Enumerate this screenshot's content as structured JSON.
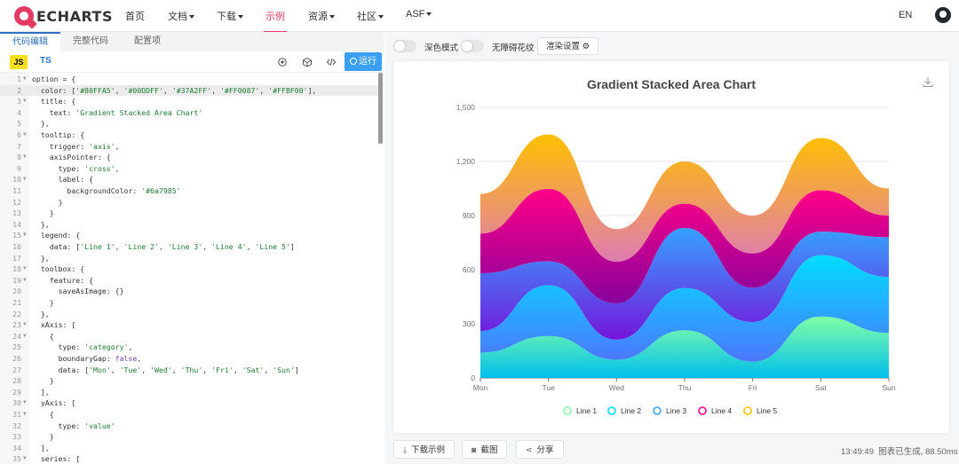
{
  "nav": {
    "logo": "ECHARTS",
    "items": [
      {
        "label": "首页",
        "caret": false
      },
      {
        "label": "文档",
        "caret": true
      },
      {
        "label": "下载",
        "caret": true
      },
      {
        "label": "示例",
        "caret": false,
        "active": true
      },
      {
        "label": "资源",
        "caret": true
      },
      {
        "label": "社区",
        "caret": true
      },
      {
        "label": "ASF",
        "caret": true
      }
    ],
    "lang": "EN",
    "github_icon": "github-icon"
  },
  "editor": {
    "tabs": [
      "代码编辑",
      "完整代码",
      "配置项"
    ],
    "active_tab": "代码编辑",
    "js_badge": "JS",
    "ts_label": "TS",
    "run_label": "运行",
    "lines": [
      {
        "n": "1",
        "fold": true,
        "html": "option = {"
      },
      {
        "n": "2",
        "fold": false,
        "hl": true,
        "html": "  color: [<s>'#80FFA5'</s>, <s>'#00DDFF'</s>, <s>'#37A2FF'</s>, <s>'#FF0087'</s>, <s>'#FFBF00'</s>],"
      },
      {
        "n": "3",
        "fold": true,
        "html": "  title: {"
      },
      {
        "n": "4",
        "fold": false,
        "html": "    text: <s>'Gradient Stacked Area Chart'</s>"
      },
      {
        "n": "5",
        "fold": false,
        "html": "  },"
      },
      {
        "n": "6",
        "fold": true,
        "html": "  tooltip: {"
      },
      {
        "n": "7",
        "fold": false,
        "html": "    trigger: <s>'axis'</s>,"
      },
      {
        "n": "8",
        "fold": true,
        "html": "    axisPointer: {"
      },
      {
        "n": "9",
        "fold": false,
        "html": "      type: <s>'cross'</s>,"
      },
      {
        "n": "10",
        "fold": true,
        "html": "      label: {"
      },
      {
        "n": "11",
        "fold": false,
        "html": "        backgroundColor: <s>'#6a7985'</s>"
      },
      {
        "n": "12",
        "fold": false,
        "html": "      }"
      },
      {
        "n": "13",
        "fold": false,
        "html": "    }"
      },
      {
        "n": "14",
        "fold": false,
        "html": "  },"
      },
      {
        "n": "15",
        "fold": true,
        "html": "  legend: {"
      },
      {
        "n": "16",
        "fold": false,
        "html": "    data: [<s>'Line 1'</s>, <s>'Line 2'</s>, <s>'Line 3'</s>, <s>'Line 4'</s>, <s>'Line 5'</s>]"
      },
      {
        "n": "17",
        "fold": false,
        "html": "  },"
      },
      {
        "n": "18",
        "fold": true,
        "html": "  toolbox: {"
      },
      {
        "n": "19",
        "fold": true,
        "html": "    feature: {"
      },
      {
        "n": "20",
        "fold": false,
        "html": "      saveAsImage: {}"
      },
      {
        "n": "21",
        "fold": false,
        "html": "    }"
      },
      {
        "n": "22",
        "fold": false,
        "html": "  },"
      },
      {
        "n": "23",
        "fold": true,
        "html": "  xAxis: ["
      },
      {
        "n": "24",
        "fold": true,
        "html": "    {"
      },
      {
        "n": "25",
        "fold": false,
        "html": "      type: <s>'category'</s>,"
      },
      {
        "n": "26",
        "fold": false,
        "html": "      boundaryGap: <k>false</k>,"
      },
      {
        "n": "27",
        "fold": false,
        "html": "      data: [<s>'Mon'</s>, <s>'Tue'</s>, <s>'Wed'</s>, <s>'Thu'</s>, <s>'Fri'</s>, <s>'Sat'</s>, <s>'Sun'</s>]"
      },
      {
        "n": "28",
        "fold": false,
        "html": "    }"
      },
      {
        "n": "29",
        "fold": false,
        "html": "  ],"
      },
      {
        "n": "30",
        "fold": true,
        "html": "  yAxis: ["
      },
      {
        "n": "31",
        "fold": true,
        "html": "    {"
      },
      {
        "n": "32",
        "fold": false,
        "html": "      type: <s>'value'</s>"
      },
      {
        "n": "33",
        "fold": false,
        "html": "    }"
      },
      {
        "n": "34",
        "fold": false,
        "html": "  ],"
      },
      {
        "n": "35",
        "fold": true,
        "html": "  series: ["
      }
    ]
  },
  "preview": {
    "dark_mode_label": "深色模式",
    "decal_label": "无障碍花纹",
    "render_label": "渲染设置",
    "download_example": "下载示例",
    "screenshot": "截图",
    "share": "分享",
    "status_time": "13:49:49",
    "status_text": "图表已生成, 88.50ms"
  },
  "chart_data": {
    "type": "area",
    "title": "Gradient Stacked Area Chart",
    "categories": [
      "Mon",
      "Tue",
      "Wed",
      "Thu",
      "Fri",
      "Sat",
      "Sun"
    ],
    "ylim": [
      0,
      1500
    ],
    "yticks": [
      0,
      300,
      600,
      900,
      1200,
      1500
    ],
    "stacked": true,
    "smooth": true,
    "grid": true,
    "legend_position": "bottom",
    "series": [
      {
        "name": "Line 1",
        "values": [
          140,
          232,
          101,
          264,
          90,
          340,
          250
        ],
        "colors": [
          "#80FFA5",
          "#01BFEC"
        ]
      },
      {
        "name": "Line 2",
        "values": [
          120,
          282,
          111,
          234,
          220,
          340,
          310
        ],
        "colors": [
          "#00DDFF",
          "#4D77FF"
        ]
      },
      {
        "name": "Line 3",
        "values": [
          320,
          132,
          201,
          334,
          190,
          130,
          220
        ],
        "colors": [
          "#37A2FF",
          "#7415DB"
        ]
      },
      {
        "name": "Line 4",
        "values": [
          220,
          402,
          231,
          134,
          190,
          230,
          120
        ],
        "colors": [
          "#FF0087",
          "#87009C"
        ]
      },
      {
        "name": "Line 5",
        "values": [
          220,
          302,
          181,
          234,
          210,
          290,
          150
        ],
        "colors": [
          "#FFBF00",
          "#E07BB3"
        ]
      }
    ],
    "legend_colors": [
      "#80FFA5",
      "#00DDFF",
      "#37A2FF",
      "#FF0087",
      "#FFBF00"
    ]
  }
}
